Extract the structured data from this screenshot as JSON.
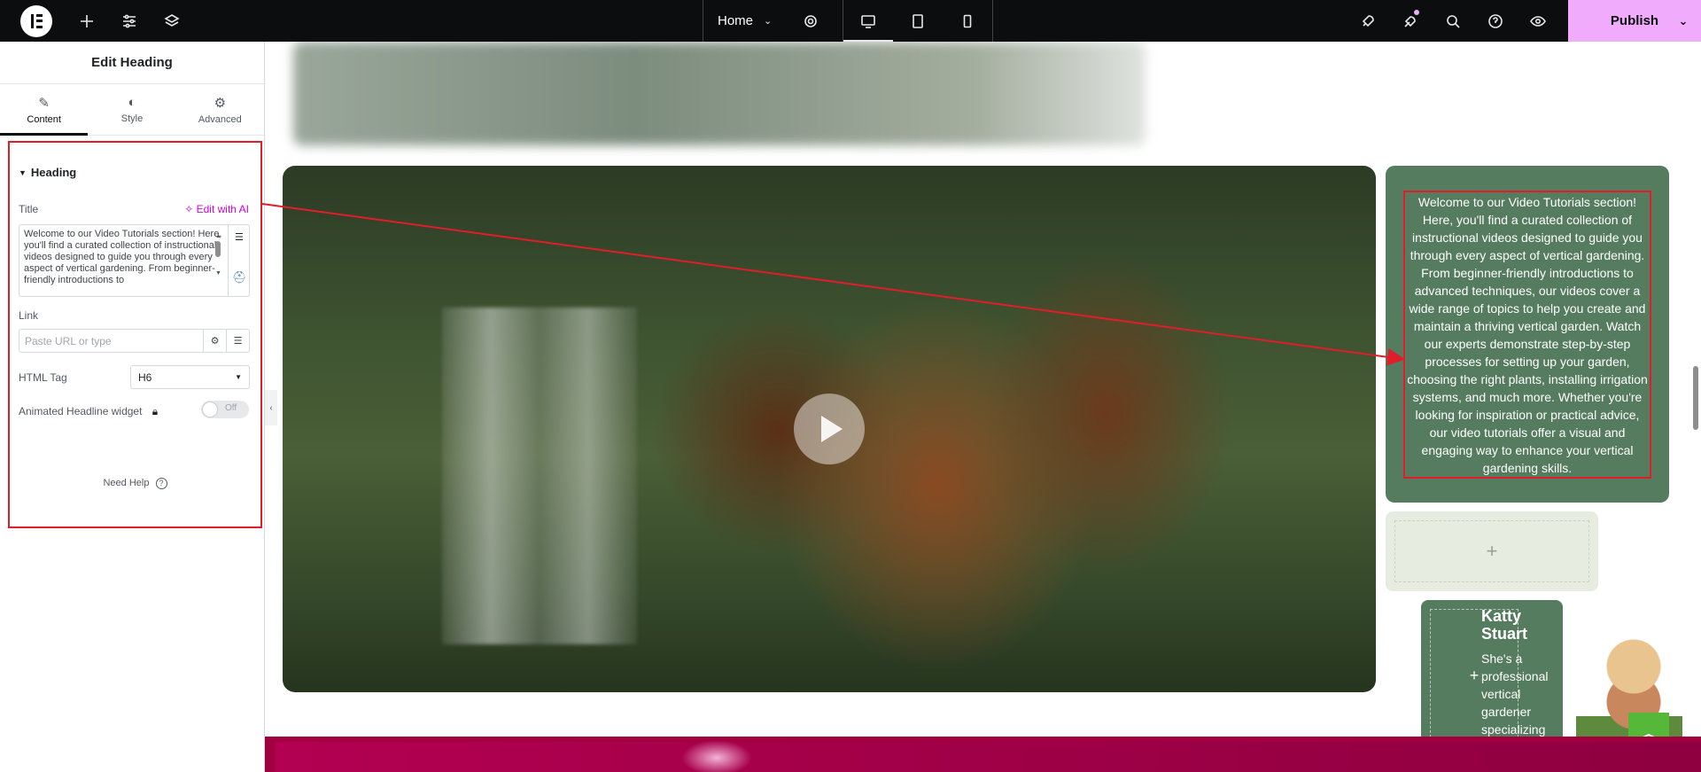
{
  "topbar": {
    "page_name": "Home",
    "publish_label": "Publish"
  },
  "panel": {
    "title": "Edit Heading",
    "tabs": [
      {
        "label": "Content"
      },
      {
        "label": "Style"
      },
      {
        "label": "Advanced"
      }
    ],
    "section_title": "Heading",
    "title_label": "Title",
    "ai_button": "Edit with AI",
    "title_value": "Welcome to our Video Tutorials section! Here, you'll find a curated collection of instructional videos designed to guide you through every aspect of vertical gardening. From beginner-friendly introductions to",
    "link_label": "Link",
    "link_placeholder": "Paste URL or type",
    "html_tag_label": "HTML Tag",
    "html_tag_value": "H6",
    "animated_label": "Animated Headline widget",
    "toggle_label": "Off",
    "help_label": "Need Help"
  },
  "canvas": {
    "heading_text": "Welcome to our Video Tutorials section! Here, you'll find a curated collection of instructional videos designed to guide you through every aspect of vertical gardening. From beginner-friendly introductions to advanced techniques, our videos cover a wide range of topics to help you create and maintain a thriving vertical garden. Watch our experts demonstrate step-by-step processes for setting up your garden, choosing the right plants, installing irrigation systems, and much more. Whether you're looking for inspiration or practical advice, our video tutorials offer a visual and engaging way to enhance your vertical gardening skills.",
    "card_name": "Katty Stuart",
    "card_bio": "She's a professional vertical gardener specializing"
  },
  "colors": {
    "accent_publish": "#f0abfc",
    "annotation_red": "#e11d2a",
    "section_green": "#557c5f",
    "footer_magenta": "#a3003f"
  }
}
